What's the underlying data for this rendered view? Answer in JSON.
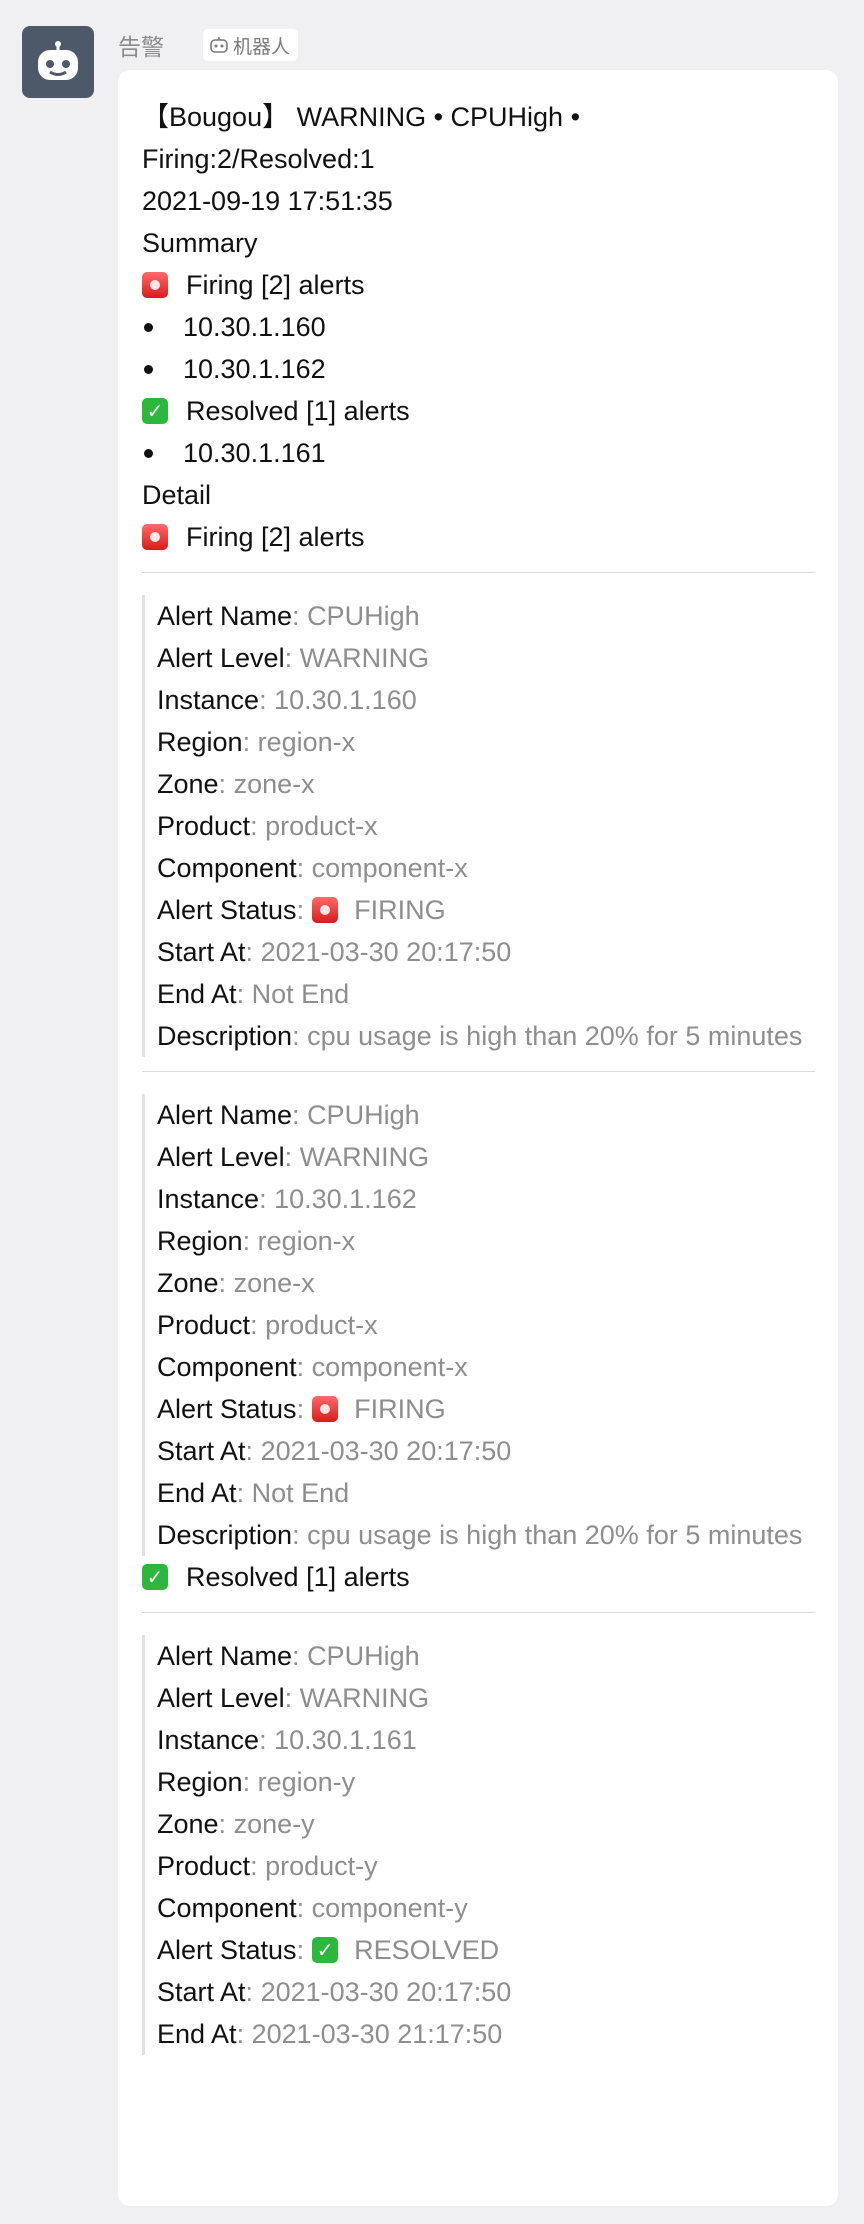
{
  "sender": {
    "name": "告警",
    "bot_tag": "机器人"
  },
  "message": {
    "header_line1": "【Bougou】 WARNING • CPUHigh •",
    "header_line2": "Firing:2/Resolved:1",
    "timestamp": "2021-09-19 17:51:35",
    "summary_title": "Summary",
    "firing_heading": "Firing [2] alerts",
    "firing_instances": [
      "10.30.1.160",
      "10.30.1.162"
    ],
    "resolved_heading": "Resolved [1] alerts",
    "resolved_instances": [
      "10.30.1.161"
    ],
    "detail_title": "Detail",
    "detail_firing_heading": "Firing [2] alerts",
    "detail_resolved_heading": "Resolved [1] alerts",
    "labels": {
      "alert_name": "Alert Name",
      "alert_level": "Alert Level",
      "instance": "Instance",
      "region": "Region",
      "zone": "Zone",
      "product": "Product",
      "component": "Component",
      "alert_status": "Alert Status",
      "start_at": "Start At",
      "end_at": "End At",
      "description": "Description"
    },
    "alerts": [
      {
        "alert_name": "CPUHigh",
        "alert_level": "WARNING",
        "instance": "10.30.1.160",
        "region": "region-x",
        "zone": "zone-x",
        "product": "product-x",
        "component": "component-x",
        "status": "FIRING",
        "start_at": "2021-03-30 20:17:50",
        "end_at": "Not End",
        "description": "cpu usage is high than 20% for 5 minutes"
      },
      {
        "alert_name": "CPUHigh",
        "alert_level": "WARNING",
        "instance": "10.30.1.162",
        "region": "region-x",
        "zone": "zone-x",
        "product": "product-x",
        "component": "component-x",
        "status": "FIRING",
        "start_at": "2021-03-30 20:17:50",
        "end_at": "Not End",
        "description": "cpu usage is high than 20% for 5 minutes"
      },
      {
        "alert_name": "CPUHigh",
        "alert_level": "WARNING",
        "instance": "10.30.1.161",
        "region": "region-y",
        "zone": "zone-y",
        "product": "product-y",
        "component": "component-y",
        "status": "RESOLVED",
        "start_at": "2021-03-30 20:17:50",
        "end_at": "2021-03-30 21:17:50"
      }
    ]
  },
  "colors": {
    "background": "#f0f0f2",
    "bubble": "#ffffff",
    "avatar": "#4d5968",
    "value_text": "#8e8e8e",
    "firing": "#d81b1b",
    "resolved": "#2db83d"
  },
  "icons": {
    "avatar": "robot-icon",
    "bot_tag": "robot-icon",
    "firing": "siren-icon",
    "resolved": "check-box-icon"
  }
}
